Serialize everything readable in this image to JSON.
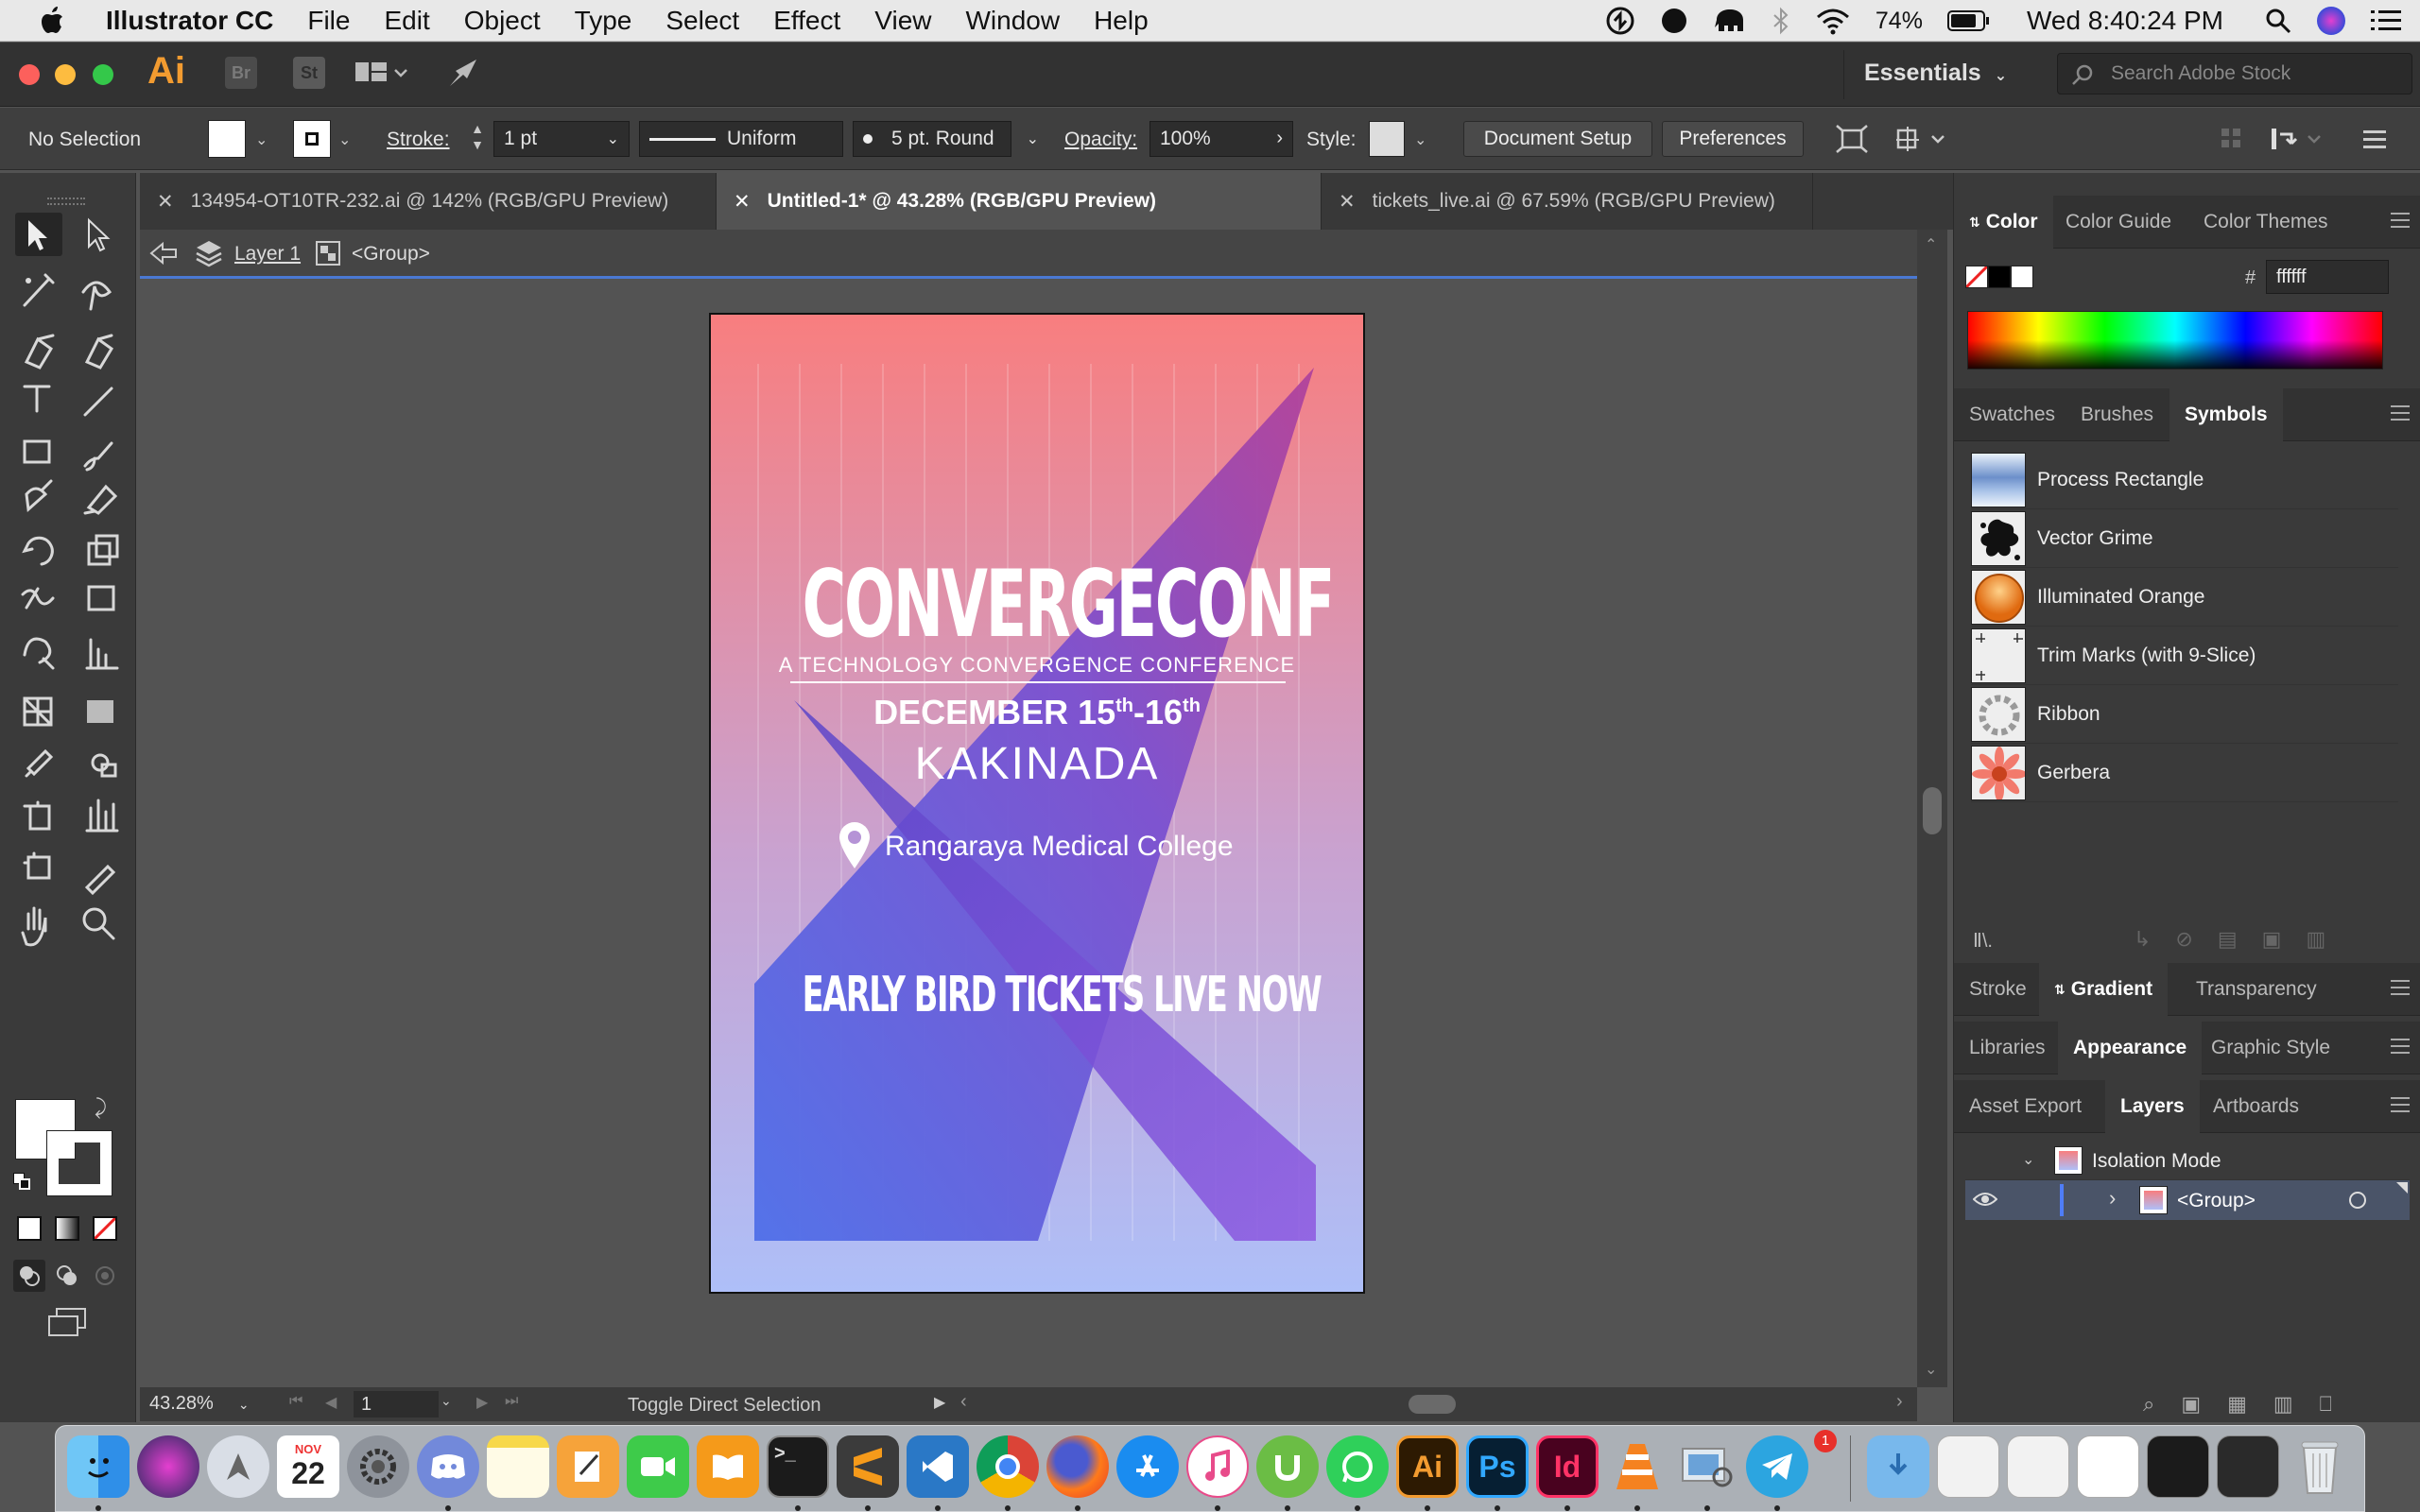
{
  "menubar": {
    "app_name": "Illustrator CC",
    "items": [
      "File",
      "Edit",
      "Object",
      "Type",
      "Select",
      "Effect",
      "View",
      "Window",
      "Help"
    ],
    "battery": "74%",
    "clock": "Wed 8:40:24 PM"
  },
  "appbar": {
    "ai_label": "Ai",
    "br_label": "Br",
    "st_label": "St",
    "workspace": "Essentials",
    "search_placeholder": "Search Adobe Stock"
  },
  "control": {
    "selection": "No Selection",
    "stroke_label": "Stroke:",
    "stroke_value": "1 pt",
    "profile": "Uniform",
    "brush": "5 pt. Round",
    "opacity_label": "Opacity:",
    "opacity_value": "100%",
    "style_label": "Style:",
    "doc_setup": "Document Setup",
    "preferences": "Preferences"
  },
  "tabs": [
    {
      "label": "134954-OT10TR-232.ai @ 142% (RGB/GPU Preview)"
    },
    {
      "label": "Untitled-1* @ 43.28% (RGB/GPU Preview)"
    },
    {
      "label": "tickets_live.ai @ 67.59% (RGB/GPU Preview)"
    }
  ],
  "breadcrumb": {
    "layer": "Layer 1",
    "group": "<Group>"
  },
  "poster": {
    "title": "CONVERGECONF",
    "subtitle": "A TECHNOLOGY CONVERGENCE CONFERENCE",
    "date_a": "DECEMBER 15",
    "sup_a": "th",
    "date_b": "-16",
    "sup_b": "th",
    "city": "KAKINADA",
    "venue": "Rangaraya Medical College",
    "cta": "EARLY BIRD TICKETS LIVE NOW"
  },
  "status": {
    "zoom": "43.28%",
    "page": "1",
    "tool_hint": "Toggle Direct Selection"
  },
  "color_panel": {
    "tabs": [
      "Color",
      "Color Guide",
      "Color Themes"
    ],
    "hash": "#",
    "hex": "ffffff"
  },
  "symbols_panel": {
    "tabs": [
      "Swatches",
      "Brushes",
      "Symbols"
    ],
    "items": [
      {
        "label": "Process Rectangle"
      },
      {
        "label": "Vector Grime"
      },
      {
        "label": "Illuminated Orange"
      },
      {
        "label": "Trim Marks (with 9-Slice)"
      },
      {
        "label": "Ribbon"
      },
      {
        "label": "Gerbera"
      }
    ]
  },
  "panel_groups": {
    "stroke_tabs": [
      "Stroke",
      "Gradient",
      "Transparency"
    ],
    "appearance_tabs": [
      "Libraries",
      "Appearance",
      "Graphic Style"
    ],
    "layers_tabs": [
      "Asset Export",
      "Layers",
      "Artboards"
    ]
  },
  "layers_panel": {
    "row1": "Isolation Mode",
    "row2": "<Group>"
  },
  "dock": {
    "calendar_month": "NOV",
    "calendar_day": "22",
    "telegram_badge": "1",
    "ps_label": "Ps",
    "id_label": "Id",
    "ai_label": "Ai"
  },
  "colors": {
    "accent": "#4a78d2",
    "ai_orange": "#f29b30",
    "poster_top": "#f87e7f",
    "poster_bottom": "#aebff8"
  }
}
